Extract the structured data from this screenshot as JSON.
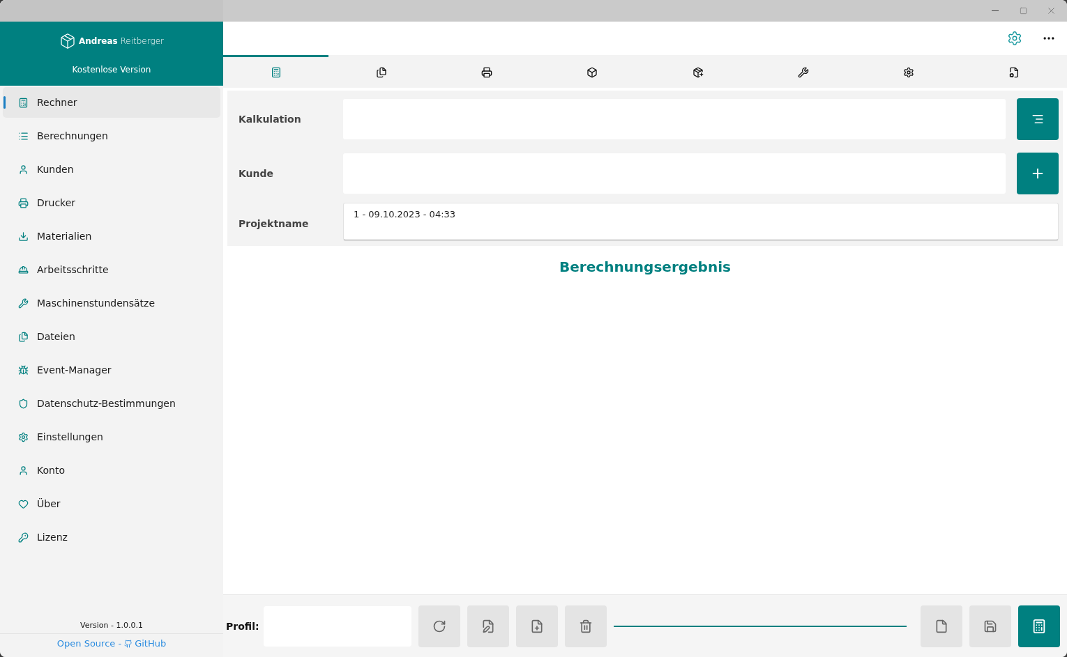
{
  "sidebar": {
    "logo": "**Andreas** Reitberger",
    "edition": "Kostenlose Version",
    "items": [
      {
        "label": "Rechner",
        "selected": true
      },
      {
        "label": "Berechnungen",
        "selected": false
      },
      {
        "label": "Kunden",
        "selected": false
      },
      {
        "label": "Drucker",
        "selected": false
      },
      {
        "label": "Materialien",
        "selected": false
      },
      {
        "label": "Arbeitsschritte",
        "selected": false
      },
      {
        "label": "Maschinenstundensätze",
        "selected": false
      },
      {
        "label": "Dateien",
        "selected": false
      },
      {
        "label": "Event-Manager",
        "selected": false
      },
      {
        "label": "Datenschutz-Bestimmungen",
        "selected": false
      },
      {
        "label": "Einstellungen",
        "selected": false
      },
      {
        "label": "Konto",
        "selected": false
      },
      {
        "label": "Über",
        "selected": false
      },
      {
        "label": "Lizenz",
        "selected": false
      }
    ],
    "version": "Version - 1.0.0.1",
    "link_left": "Open Source -",
    "link_right": "GitHub"
  },
  "tabs": [
    {
      "selected": true
    },
    {
      "selected": false
    },
    {
      "selected": false
    },
    {
      "selected": false
    },
    {
      "selected": false
    },
    {
      "selected": false
    },
    {
      "selected": false
    },
    {
      "selected": false
    }
  ],
  "form": {
    "fields": [
      {
        "label": "Kalkulation",
        "kind": "list"
      },
      {
        "label": "Kunde",
        "kind": "add"
      },
      {
        "label": "Projektname",
        "value": "1 - 09.10.2023 - 04:33",
        "kind": "text"
      }
    ],
    "result_title": "Berechnungsergebnis"
  },
  "bottom": {
    "profile_label": "Profil:"
  }
}
